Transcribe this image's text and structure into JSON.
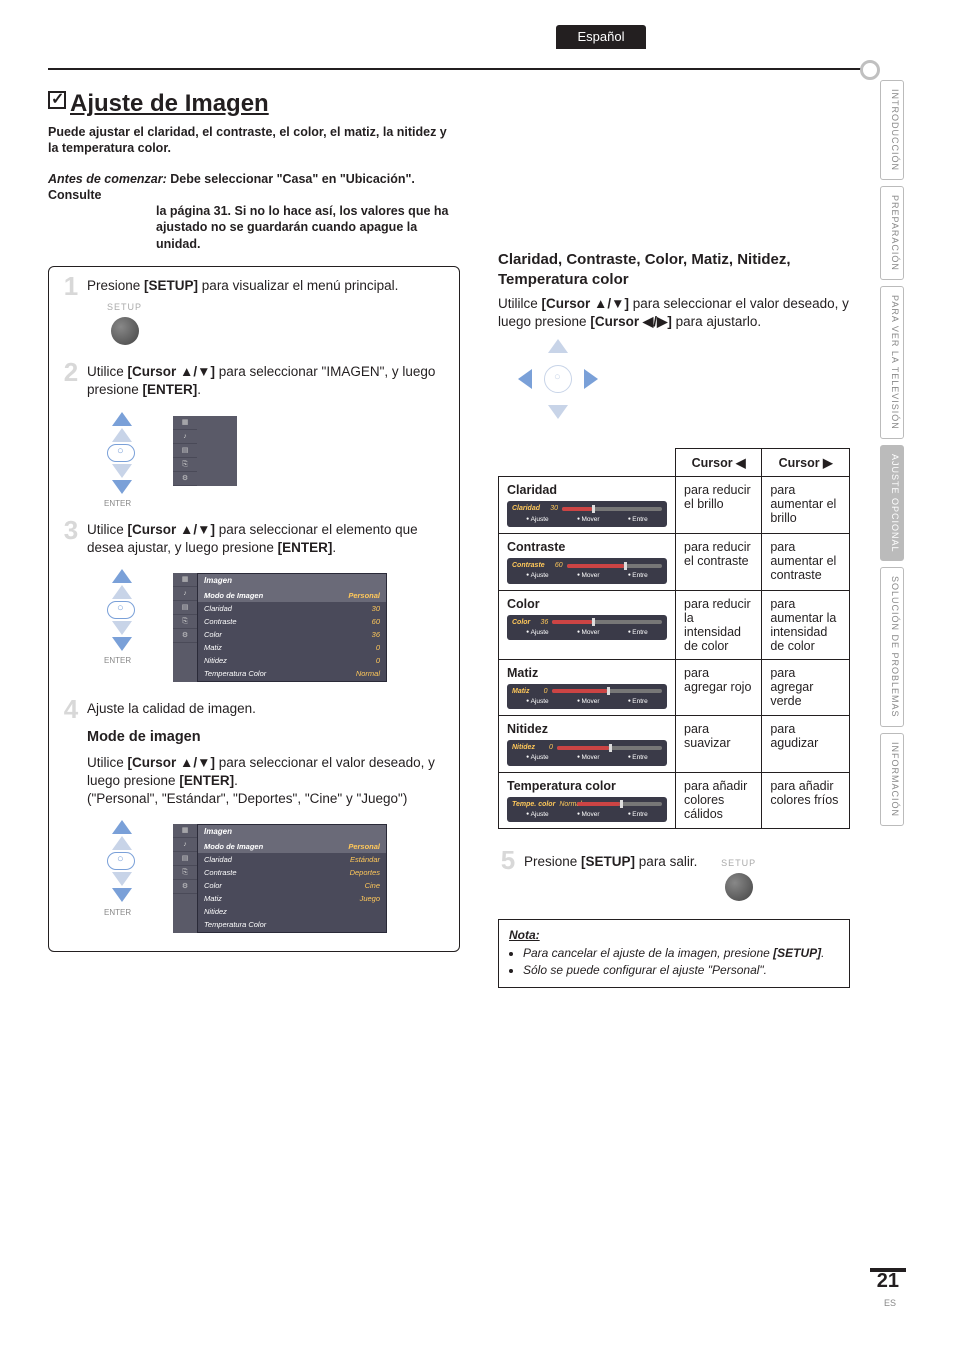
{
  "header": {
    "language_tab": "Español"
  },
  "sidebar": {
    "tabs": [
      "INTRODUCCIÓN",
      "PREPARACIÓN",
      "PARA VER LA TELEVISIÓN",
      "AJUSTE OPCIONAL",
      "SOLUCIÓN DE PROBLEMAS",
      "INFORMACIÓN"
    ],
    "active_index": 3
  },
  "title": {
    "text": "Ajuste de Imagen",
    "icon": "checkbox-checked"
  },
  "intro": "Puede ajustar el claridad, el contraste, el color, el matiz, la nitidez y la temperatura color.",
  "before": {
    "label": "Antes de comenzar:",
    "text": "Debe seleccionar \"Casa\" en \"Ubicación\". Consulte la página 31. Si no lo hace así, los valores que ha ajustado no se guardarán cuando apague la unidad."
  },
  "steps": {
    "s1": {
      "num": "1",
      "text_pre": "Presione ",
      "btn": "[SETUP]",
      "text_post": " para visualizar el menú principal.",
      "setup_label": "SETUP"
    },
    "s2": {
      "num": "2",
      "text": "Utilice [Cursor ▲/▼] para seleccionar \"IMAGEN\", y luego presione [ENTER].",
      "enter_label": "ENTER"
    },
    "s3": {
      "num": "3",
      "text": "Utilice [Cursor ▲/▼] para seleccionar el elemento que desea ajustar, y luego presione [ENTER].",
      "enter_label": "ENTER",
      "menu_title": "Imagen",
      "rows": [
        {
          "k": "Modo de Imagen",
          "v": "Personal",
          "sel": true
        },
        {
          "k": "Claridad",
          "v": "30"
        },
        {
          "k": "Contraste",
          "v": "60"
        },
        {
          "k": "Color",
          "v": "36"
        },
        {
          "k": "Matiz",
          "v": "0"
        },
        {
          "k": "Nitidez",
          "v": "0"
        },
        {
          "k": "Temperatura Color",
          "v": "Normal"
        }
      ]
    },
    "s4": {
      "num": "4",
      "text": "Ajuste la calidad de imagen.",
      "sub_heading": "Mode de imagen",
      "sub_text": "Utilice [Cursor ▲/▼] para seleccionar el valor deseado, y luego presione [ENTER].",
      "sub_options": "(\"Personal\", \"Estándar\", \"Deportes\", \"Cine\" y \"Juego\")",
      "enter_label": "ENTER",
      "menu_title": "Imagen",
      "rows": [
        {
          "k": "Modo de Imagen",
          "v": "Personal",
          "sel": true
        },
        {
          "k": "Claridad",
          "v": "Estándar"
        },
        {
          "k": "Contraste",
          "v": "Deportes"
        },
        {
          "k": "Color",
          "v": "Cine"
        },
        {
          "k": "Matiz",
          "v": "Juego"
        },
        {
          "k": "Nitidez",
          "v": ""
        },
        {
          "k": "Temperatura Color",
          "v": ""
        }
      ]
    },
    "s5": {
      "num": "5",
      "text_pre": "Presione ",
      "btn": "[SETUP]",
      "text_post": " para salir.",
      "setup_label": "SETUP"
    }
  },
  "right": {
    "heading": "Claridad, Contraste, Color, Matiz, Nitidez, Temperatura color",
    "text": "Utililce [Cursor ▲/▼] para seleccionar el valor deseado, y luego presione [Cursor ◀/▶] para ajustarlo.",
    "table": {
      "head_left": "Cursor ◀",
      "head_right": "Cursor ▶",
      "controls": {
        "ajuste": "Ajuste",
        "mover": "Mover",
        "entre": "Entre"
      },
      "rows": [
        {
          "name": "Claridad",
          "slider_label": "Claridad",
          "slider_val": "30",
          "fill": 30,
          "left": "para reducir el brillo",
          "right": "para aumentar el brillo"
        },
        {
          "name": "Contraste",
          "slider_label": "Contraste",
          "slider_val": "60",
          "fill": 60,
          "left": "para reducir el contraste",
          "right": "para aumentar el contraste"
        },
        {
          "name": "Color",
          "slider_label": "Color",
          "slider_val": "36",
          "fill": 36,
          "left": "para reducir la intensidad de color",
          "right": "para aumentar la intensidad de color"
        },
        {
          "name": "Matiz",
          "slider_label": "Matiz",
          "slider_val": "0",
          "fill": 50,
          "left": "para agregar rojo",
          "right": "para agregar verde"
        },
        {
          "name": "Nitidez",
          "slider_label": "Nitidez",
          "slider_val": "0",
          "fill": 50,
          "left": "para suavizar",
          "right": "para agudizar"
        },
        {
          "name": "Temperatura color",
          "slider_label": "Tempe. color",
          "slider_val": "Normal",
          "fill": 50,
          "left": "para añadir colores cálidos",
          "right": "para añadir colores fríos"
        }
      ]
    }
  },
  "note": {
    "title": "Nota:",
    "items": [
      "Para cancelar el ajuste de la imagen, presione [SETUP].",
      "Sólo se puede configurar el ajuste \"Personal\"."
    ]
  },
  "footer": {
    "page": "21",
    "lang": "ES"
  }
}
